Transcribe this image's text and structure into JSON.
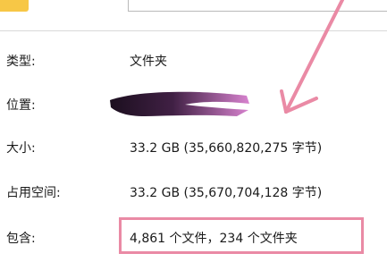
{
  "properties": {
    "type": {
      "label": "类型:",
      "value": "文件夹"
    },
    "location": {
      "label": "位置:"
    },
    "size": {
      "label": "大小:",
      "value": "33.2 GB (35,660,820,275 字节)"
    },
    "size_on_disk": {
      "label": "占用空间:",
      "value": "33.2 GB (35,670,704,128 字节)"
    },
    "contains": {
      "label": "包含:",
      "value": "4,861 个文件，234 个文件夹"
    }
  },
  "colors": {
    "annotation": "#ea8aa5",
    "redaction_dark": "#1c0f1f",
    "redaction_light": "#d883cf",
    "folder": "#f7c746"
  },
  "icons": {
    "folder": "folder-icon",
    "annotation_arrow": "annotation-arrow-icon"
  }
}
